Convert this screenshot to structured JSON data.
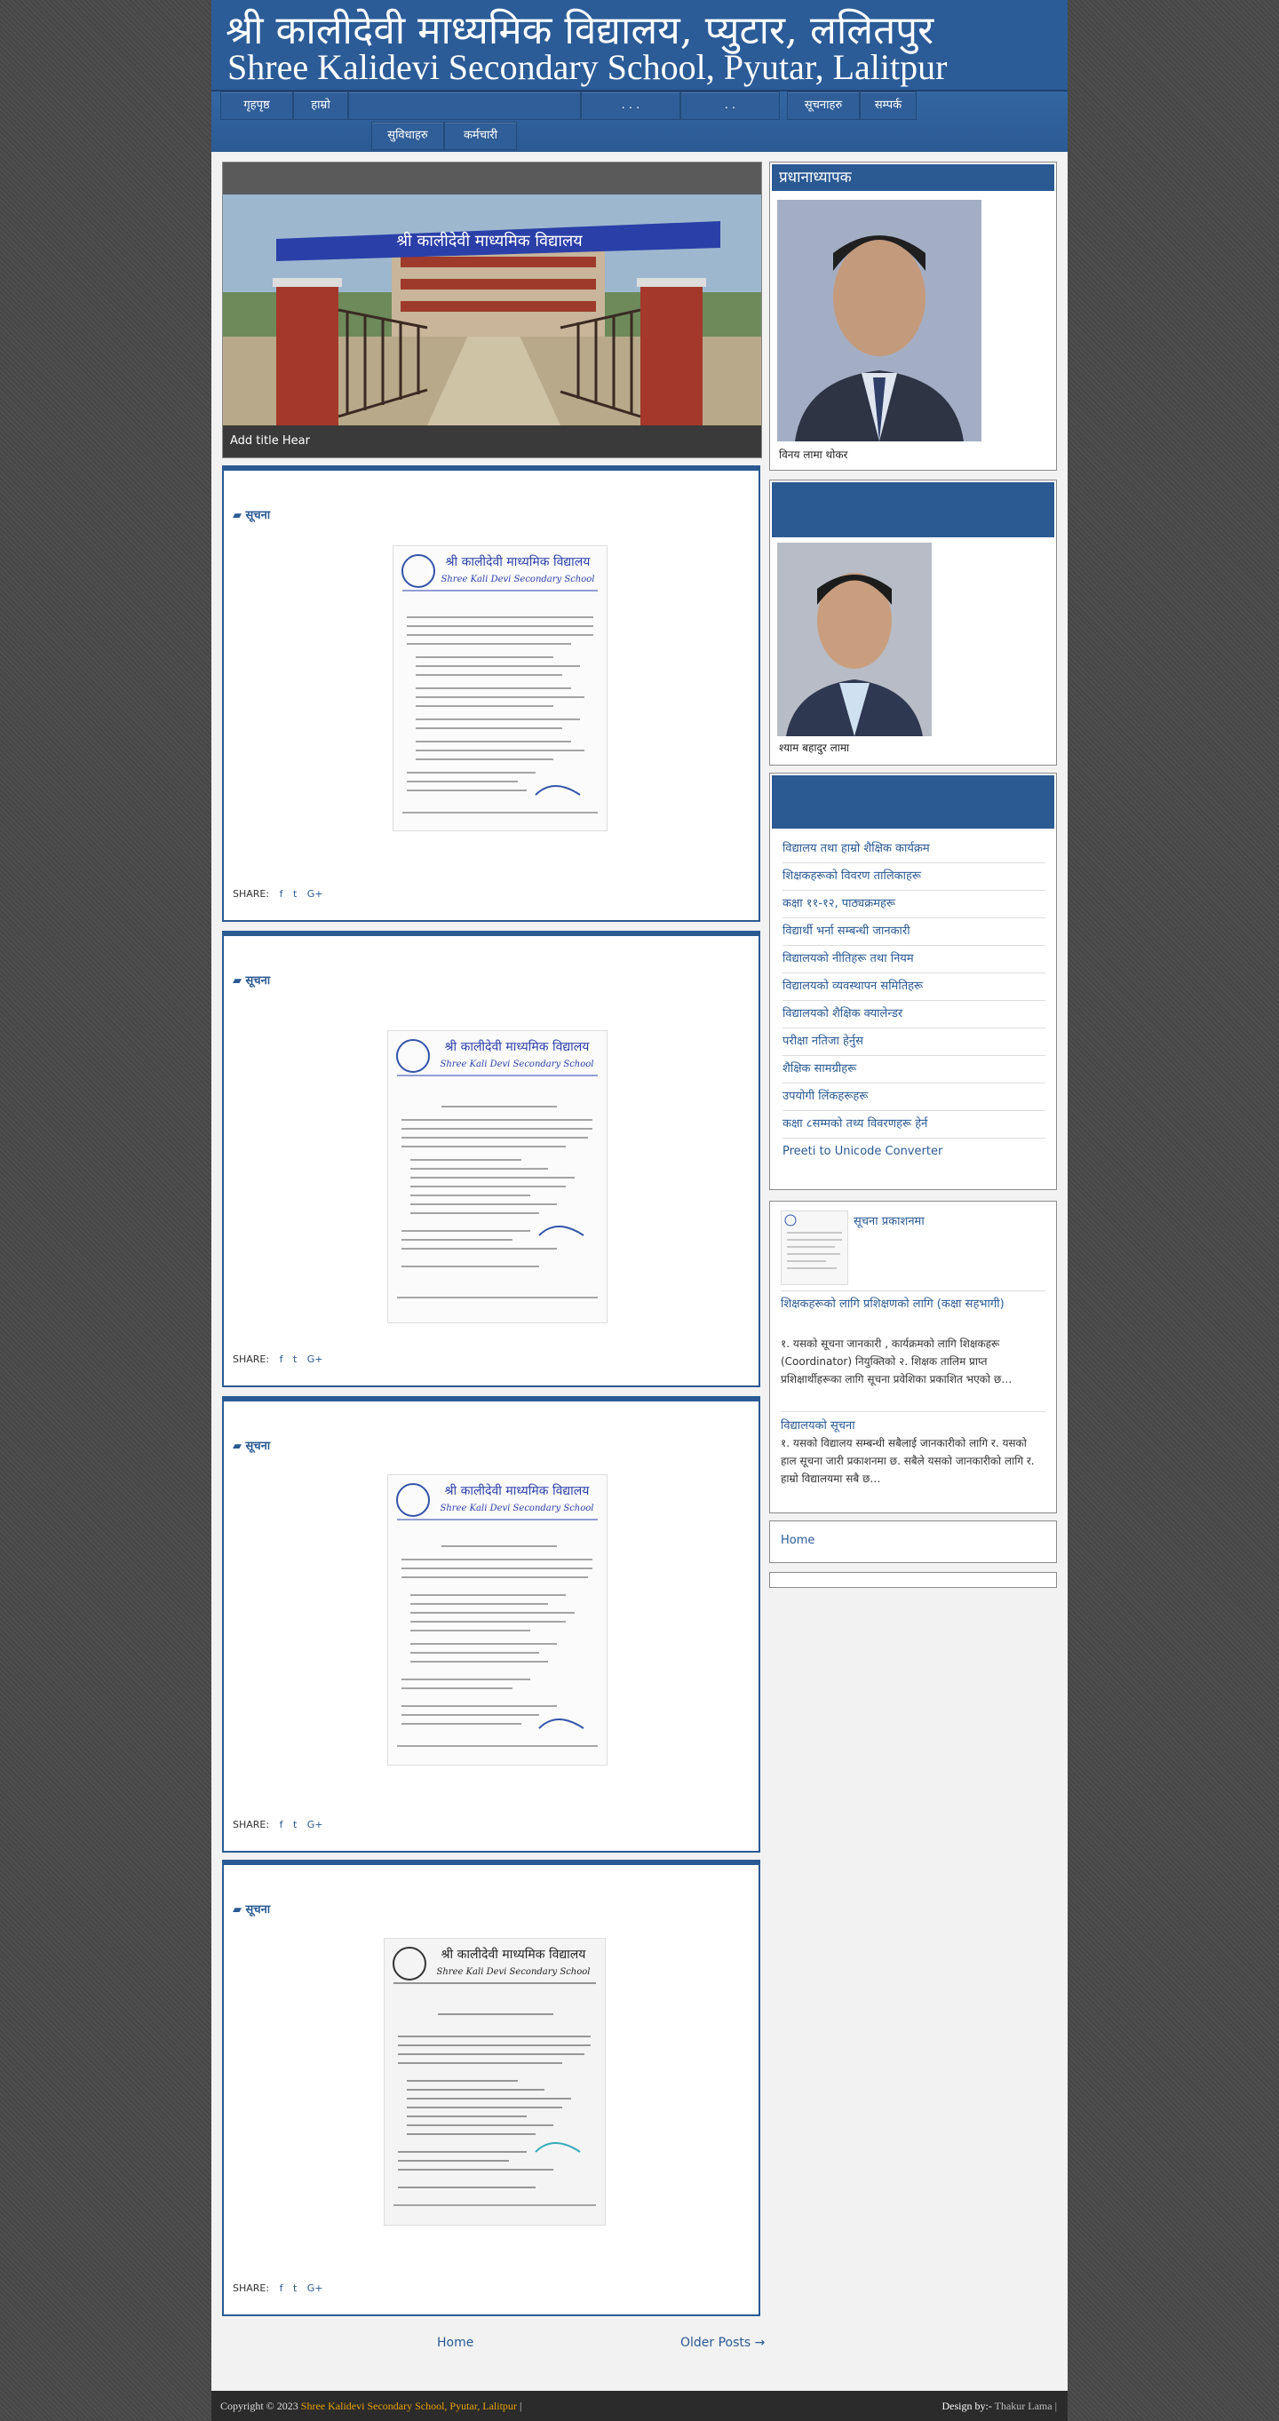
{
  "header": {
    "title_np": "श्री कालीदेवी माध्यमिक विद्यालय, प्युटार, ललितपुर",
    "title_en": "Shree Kalidevi Secondary School, Pyutar, Lalitpur"
  },
  "nav": {
    "items": [
      "गृहपृष्ठ",
      "हाम्रो",
      "",
      ". . .",
      ". .",
      "",
      "सूचनाहरु",
      "सम्पर्क",
      "सुविधाहरु",
      "कर्मचारी"
    ]
  },
  "slider": {
    "caption": "Add title Hear"
  },
  "posts": [
    {
      "category": "सूचना",
      "share_label": "SHARE:"
    },
    {
      "category": "सूचना",
      "share_label": "SHARE:"
    },
    {
      "category": "सूचना",
      "share_label": "SHARE:"
    },
    {
      "category": "सूचना",
      "share_label": "SHARE:"
    }
  ],
  "document": {
    "school_np": "श्री कालीदेवी माध्यमिक विद्यालय",
    "school_en": "Shree Kali Devi Secondary School"
  },
  "share_icons": [
    "facebook-icon",
    "twitter-icon",
    "google-plus-icon"
  ],
  "sidebar": {
    "principal": {
      "heading": "प्रधानाध्यापक",
      "name": "विनय लामा थोकर"
    },
    "chairperson": {
      "heading": "",
      "name": "श्याम बहादुर लामा"
    },
    "links": {
      "heading": "",
      "items": [
        "विद्यालय तथा हाम्रो शैक्षिक कार्यक्रम",
        "शिक्षकहरूको विवरण तालिकाहरू",
        "कक्षा ११-१२, पाठ्यक्रमहरू",
        "विद्यार्थी भर्ना सम्बन्धी जानकारी",
        "विद्यालयको नीतिहरू तथा नियम",
        "विद्यालयको व्यवस्थापन समितिहरू",
        "विद्यालयको शैक्षिक क्यालेन्डर",
        "परीक्षा नतिजा हेर्नुस",
        "शैक्षिक सामग्रीहरू",
        "उपयोगी लिंकहरूहरू",
        "कक्षा ८सम्मको तथ्य विवरणहरू हेर्न",
        "Preeti to Unicode Converter"
      ]
    },
    "recent": {
      "item1_title": "सूचना प्रकाशनमा",
      "item2_title": "शिक्षकहरूको लागि प्रशिक्षणको लागि (कक्षा सहभागी)",
      "item2_text": "१. यसको सूचना जानकारी , कार्यक्रमको लागि शिक्षकहरू (Coordinator) नियुक्तिको २. शिक्षक तालिम प्राप्त प्रशिक्षार्थीहरूका लागि सूचना प्रवेशिका प्रकाशित भएको छ…",
      "item3_title": "विद्यालयको सूचना",
      "item3_text": "१. यसको विद्यालय सम्बन्धी सबैलाई जानकारीको लागि र. यसको हाल सूचना जारी   प्रकाशनमा छ. सबैले यसको जानकारीको लागि र. हाम्रो विद्यालयमा सबै छ…"
    },
    "home_widget": "Home"
  },
  "pager": {
    "home": "Home",
    "older": "Older Posts →"
  },
  "footer": {
    "copyright_prefix": "Copyright © 2023",
    "copyright_link": "Shree Kalidevi Secondary School, Pyutar, Lalitpur",
    "copyright_suffix": "|",
    "design_prefix": "Design by:-",
    "design_name": "Thakur Lama |"
  }
}
